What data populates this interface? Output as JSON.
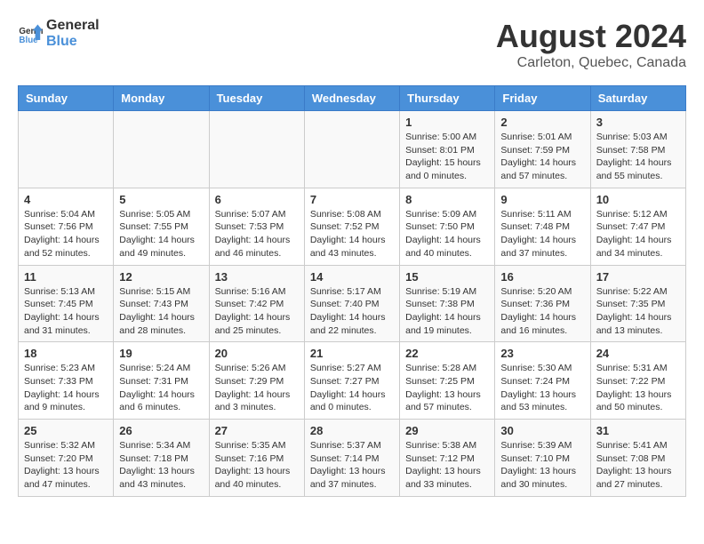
{
  "header": {
    "logo_general": "General",
    "logo_blue": "Blue",
    "title": "August 2024",
    "subtitle": "Carleton, Quebec, Canada"
  },
  "calendar": {
    "days_of_week": [
      "Sunday",
      "Monday",
      "Tuesday",
      "Wednesday",
      "Thursday",
      "Friday",
      "Saturday"
    ],
    "weeks": [
      [
        {
          "day": "",
          "info": ""
        },
        {
          "day": "",
          "info": ""
        },
        {
          "day": "",
          "info": ""
        },
        {
          "day": "",
          "info": ""
        },
        {
          "day": "1",
          "info": "Sunrise: 5:00 AM\nSunset: 8:01 PM\nDaylight: 15 hours\nand 0 minutes."
        },
        {
          "day": "2",
          "info": "Sunrise: 5:01 AM\nSunset: 7:59 PM\nDaylight: 14 hours\nand 57 minutes."
        },
        {
          "day": "3",
          "info": "Sunrise: 5:03 AM\nSunset: 7:58 PM\nDaylight: 14 hours\nand 55 minutes."
        }
      ],
      [
        {
          "day": "4",
          "info": "Sunrise: 5:04 AM\nSunset: 7:56 PM\nDaylight: 14 hours\nand 52 minutes."
        },
        {
          "day": "5",
          "info": "Sunrise: 5:05 AM\nSunset: 7:55 PM\nDaylight: 14 hours\nand 49 minutes."
        },
        {
          "day": "6",
          "info": "Sunrise: 5:07 AM\nSunset: 7:53 PM\nDaylight: 14 hours\nand 46 minutes."
        },
        {
          "day": "7",
          "info": "Sunrise: 5:08 AM\nSunset: 7:52 PM\nDaylight: 14 hours\nand 43 minutes."
        },
        {
          "day": "8",
          "info": "Sunrise: 5:09 AM\nSunset: 7:50 PM\nDaylight: 14 hours\nand 40 minutes."
        },
        {
          "day": "9",
          "info": "Sunrise: 5:11 AM\nSunset: 7:48 PM\nDaylight: 14 hours\nand 37 minutes."
        },
        {
          "day": "10",
          "info": "Sunrise: 5:12 AM\nSunset: 7:47 PM\nDaylight: 14 hours\nand 34 minutes."
        }
      ],
      [
        {
          "day": "11",
          "info": "Sunrise: 5:13 AM\nSunset: 7:45 PM\nDaylight: 14 hours\nand 31 minutes."
        },
        {
          "day": "12",
          "info": "Sunrise: 5:15 AM\nSunset: 7:43 PM\nDaylight: 14 hours\nand 28 minutes."
        },
        {
          "day": "13",
          "info": "Sunrise: 5:16 AM\nSunset: 7:42 PM\nDaylight: 14 hours\nand 25 minutes."
        },
        {
          "day": "14",
          "info": "Sunrise: 5:17 AM\nSunset: 7:40 PM\nDaylight: 14 hours\nand 22 minutes."
        },
        {
          "day": "15",
          "info": "Sunrise: 5:19 AM\nSunset: 7:38 PM\nDaylight: 14 hours\nand 19 minutes."
        },
        {
          "day": "16",
          "info": "Sunrise: 5:20 AM\nSunset: 7:36 PM\nDaylight: 14 hours\nand 16 minutes."
        },
        {
          "day": "17",
          "info": "Sunrise: 5:22 AM\nSunset: 7:35 PM\nDaylight: 14 hours\nand 13 minutes."
        }
      ],
      [
        {
          "day": "18",
          "info": "Sunrise: 5:23 AM\nSunset: 7:33 PM\nDaylight: 14 hours\nand 9 minutes."
        },
        {
          "day": "19",
          "info": "Sunrise: 5:24 AM\nSunset: 7:31 PM\nDaylight: 14 hours\nand 6 minutes."
        },
        {
          "day": "20",
          "info": "Sunrise: 5:26 AM\nSunset: 7:29 PM\nDaylight: 14 hours\nand 3 minutes."
        },
        {
          "day": "21",
          "info": "Sunrise: 5:27 AM\nSunset: 7:27 PM\nDaylight: 14 hours\nand 0 minutes."
        },
        {
          "day": "22",
          "info": "Sunrise: 5:28 AM\nSunset: 7:25 PM\nDaylight: 13 hours\nand 57 minutes."
        },
        {
          "day": "23",
          "info": "Sunrise: 5:30 AM\nSunset: 7:24 PM\nDaylight: 13 hours\nand 53 minutes."
        },
        {
          "day": "24",
          "info": "Sunrise: 5:31 AM\nSunset: 7:22 PM\nDaylight: 13 hours\nand 50 minutes."
        }
      ],
      [
        {
          "day": "25",
          "info": "Sunrise: 5:32 AM\nSunset: 7:20 PM\nDaylight: 13 hours\nand 47 minutes."
        },
        {
          "day": "26",
          "info": "Sunrise: 5:34 AM\nSunset: 7:18 PM\nDaylight: 13 hours\nand 43 minutes."
        },
        {
          "day": "27",
          "info": "Sunrise: 5:35 AM\nSunset: 7:16 PM\nDaylight: 13 hours\nand 40 minutes."
        },
        {
          "day": "28",
          "info": "Sunrise: 5:37 AM\nSunset: 7:14 PM\nDaylight: 13 hours\nand 37 minutes."
        },
        {
          "day": "29",
          "info": "Sunrise: 5:38 AM\nSunset: 7:12 PM\nDaylight: 13 hours\nand 33 minutes."
        },
        {
          "day": "30",
          "info": "Sunrise: 5:39 AM\nSunset: 7:10 PM\nDaylight: 13 hours\nand 30 minutes."
        },
        {
          "day": "31",
          "info": "Sunrise: 5:41 AM\nSunset: 7:08 PM\nDaylight: 13 hours\nand 27 minutes."
        }
      ]
    ]
  }
}
